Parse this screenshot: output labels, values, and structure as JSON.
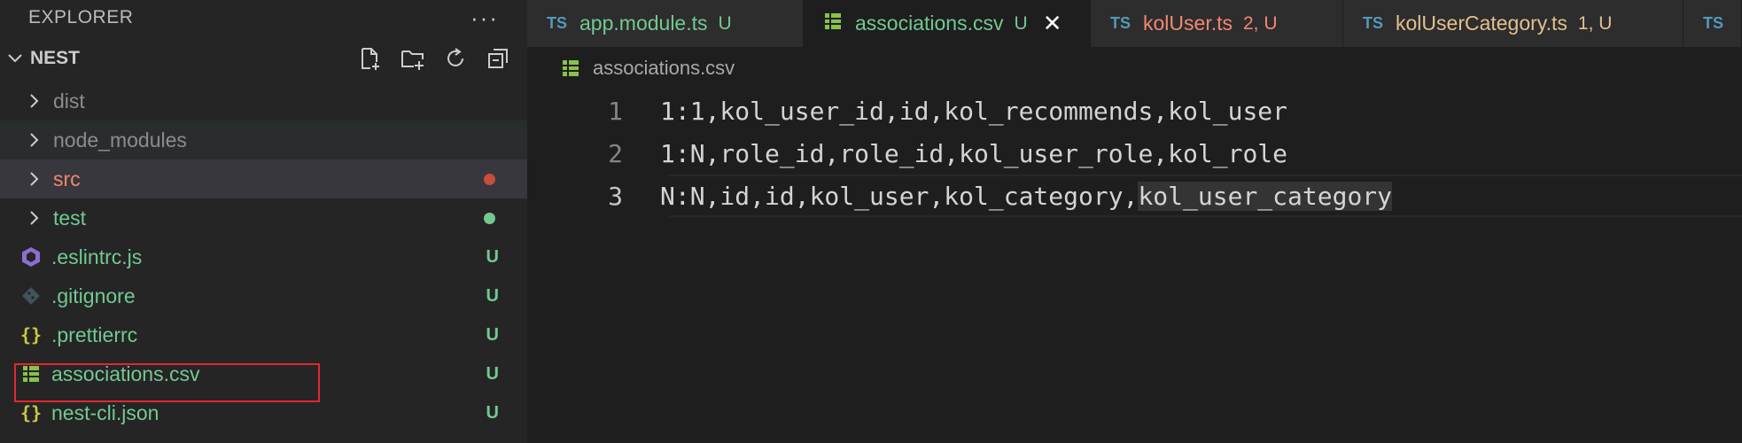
{
  "sidebar": {
    "explorer_title": "EXPLORER",
    "more_label": "···",
    "section_title": "NEST",
    "items": [
      {
        "label": "dist",
        "kind": "folder",
        "status": ""
      },
      {
        "label": "node_modules",
        "kind": "folder",
        "status": ""
      },
      {
        "label": "src",
        "kind": "folder",
        "status": ""
      },
      {
        "label": "test",
        "kind": "folder",
        "status": ""
      },
      {
        "label": ".eslintrc.js",
        "kind": "file",
        "icon": "eslint-icon",
        "status": "U"
      },
      {
        "label": ".gitignore",
        "kind": "file",
        "icon": "git-icon",
        "status": "U"
      },
      {
        "label": ".prettierrc",
        "kind": "file",
        "icon": "json-braces-icon",
        "icon_text": "{}",
        "status": "U"
      },
      {
        "label": "associations.csv",
        "kind": "file",
        "icon": "csv-table-icon",
        "status": "U"
      },
      {
        "label": "nest-cli.json",
        "kind": "file",
        "icon": "json-braces-icon",
        "icon_text": "{}",
        "status": "U"
      }
    ],
    "colors": {
      "modified_dot": "#c74e39",
      "untracked_dot": "#73c991"
    }
  },
  "tabs": [
    {
      "lang": "TS",
      "name": "app.module.ts",
      "badge": "U"
    },
    {
      "lang": "",
      "name": "associations.csv",
      "badge": "U",
      "close": "✕"
    },
    {
      "lang": "TS",
      "name": "kolUser.ts",
      "badge": "2, U"
    },
    {
      "lang": "TS",
      "name": "kolUserCategory.ts",
      "badge": "1, U"
    },
    {
      "lang": "TS",
      "name": ""
    }
  ],
  "editor": {
    "breadcrumb": "associations.csv",
    "lines": [
      {
        "num": "1",
        "text": "1:1,kol_user_id,id,kol_recommends,kol_user"
      },
      {
        "num": "2",
        "text": "1:N,role_id,role_id,kol_user_role,kol_role"
      },
      {
        "num": "3",
        "text_a": "N:N,id,id,kol_user,kol_category,",
        "text_b": "kol_user_category"
      }
    ]
  }
}
